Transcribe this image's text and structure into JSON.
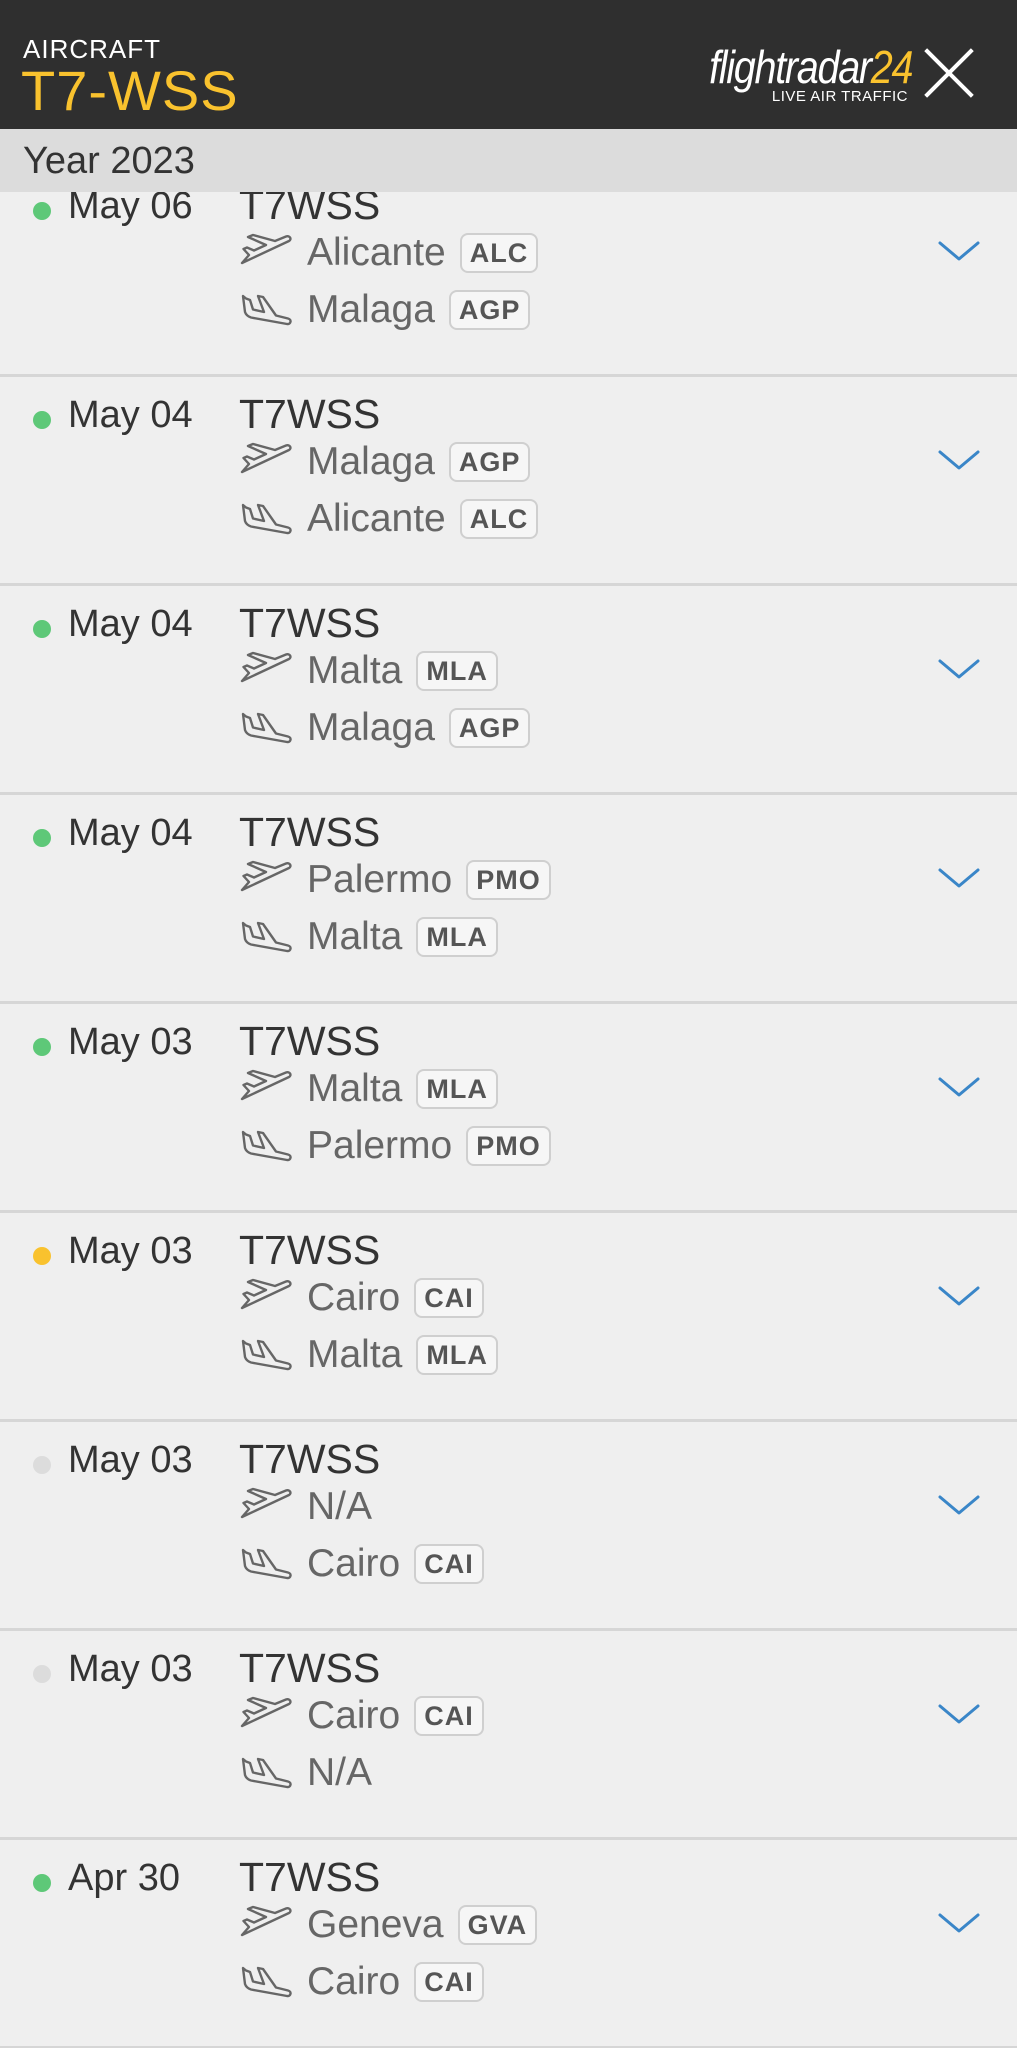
{
  "header": {
    "label": "AIRCRAFT",
    "registration": "T7-WSS",
    "logo_main_white": "flightradar",
    "logo_main_yellow": "24",
    "logo_sub": "LIVE AIR TRAFFIC",
    "close_icon": "close-icon"
  },
  "year_label": "Year 2023",
  "colors": {
    "accent_yellow": "#f9c22e",
    "header_bg": "#2f2f2f",
    "chevron_blue": "#3a86c8",
    "status_green": "#5ec878",
    "status_yellow": "#f9c22e",
    "status_gray": "#dcdcdc"
  },
  "flights": [
    {
      "date": "May 06",
      "flight": "T7WSS",
      "status": "green",
      "dep_city": "Alicante",
      "dep_code": "ALC",
      "arr_city": "Malaga",
      "arr_code": "AGP"
    },
    {
      "date": "May 04",
      "flight": "T7WSS",
      "status": "green",
      "dep_city": "Malaga",
      "dep_code": "AGP",
      "arr_city": "Alicante",
      "arr_code": "ALC"
    },
    {
      "date": "May 04",
      "flight": "T7WSS",
      "status": "green",
      "dep_city": "Malta",
      "dep_code": "MLA",
      "arr_city": "Malaga",
      "arr_code": "AGP"
    },
    {
      "date": "May 04",
      "flight": "T7WSS",
      "status": "green",
      "dep_city": "Palermo",
      "dep_code": "PMO",
      "arr_city": "Malta",
      "arr_code": "MLA"
    },
    {
      "date": "May 03",
      "flight": "T7WSS",
      "status": "green",
      "dep_city": "Malta",
      "dep_code": "MLA",
      "arr_city": "Palermo",
      "arr_code": "PMO"
    },
    {
      "date": "May 03",
      "flight": "T7WSS",
      "status": "yellow",
      "dep_city": "Cairo",
      "dep_code": "CAI",
      "arr_city": "Malta",
      "arr_code": "MLA"
    },
    {
      "date": "May 03",
      "flight": "T7WSS",
      "status": "gray",
      "dep_city": "N/A",
      "dep_code": "",
      "arr_city": "Cairo",
      "arr_code": "CAI"
    },
    {
      "date": "May 03",
      "flight": "T7WSS",
      "status": "gray",
      "dep_city": "Cairo",
      "dep_code": "CAI",
      "arr_city": "N/A",
      "arr_code": ""
    },
    {
      "date": "Apr 30",
      "flight": "T7WSS",
      "status": "green",
      "dep_city": "Geneva",
      "dep_code": "GVA",
      "arr_city": "Cairo",
      "arr_code": "CAI"
    }
  ]
}
